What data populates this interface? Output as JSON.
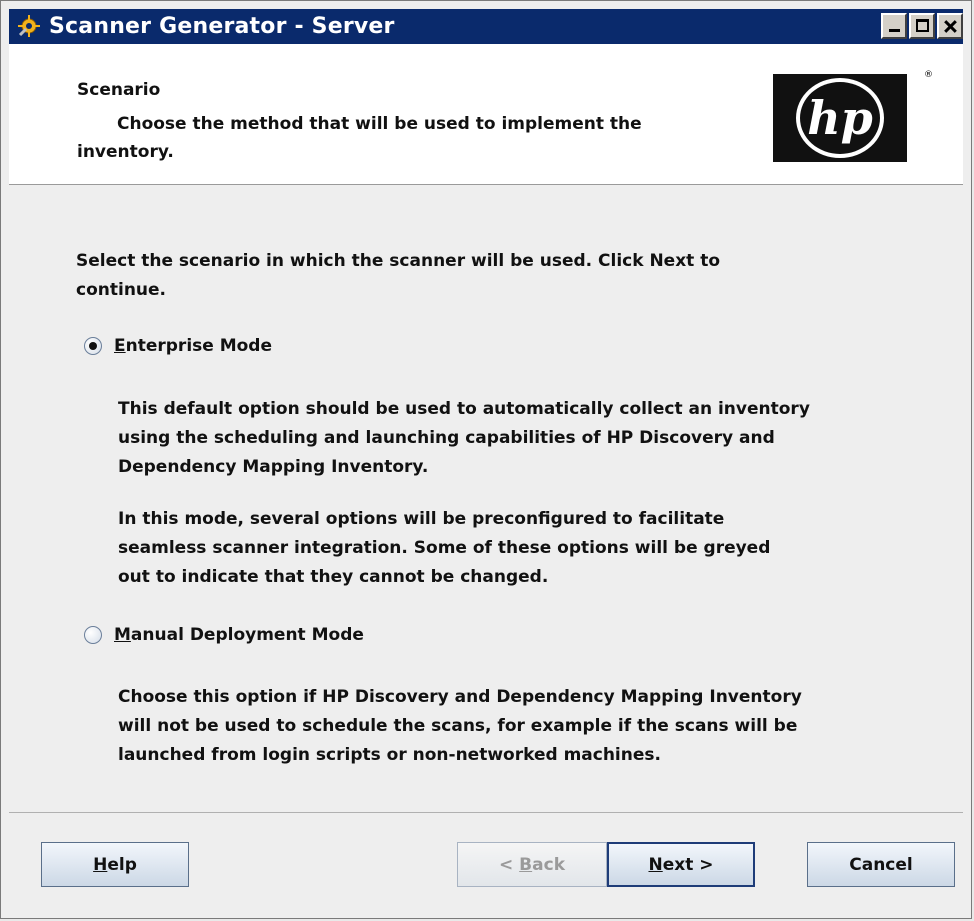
{
  "window": {
    "title": "Scanner Generator - Server"
  },
  "header": {
    "title": "Scenario",
    "description_line1": "Choose the method that will be used to implement the",
    "description_line2": "inventory.",
    "logo_text": "hp",
    "logo_mark": "®"
  },
  "intro": {
    "line1": "Select the scenario in which the scanner will be used.  Click Next to",
    "line2": "continue."
  },
  "options": [
    {
      "mnemonic": "E",
      "label_rest": "nterprise Mode",
      "selected": true,
      "paragraphs": [
        [
          "This default option should be used to automatically collect an inventory",
          "using the scheduling and launching capabilities of HP Discovery and",
          "Dependency Mapping Inventory."
        ],
        [
          "In this mode, several options will be preconfigured to facilitate",
          "seamless scanner integration.  Some of these options will be greyed",
          "out to indicate that they cannot be changed."
        ]
      ]
    },
    {
      "mnemonic": "M",
      "label_rest": "anual Deployment Mode",
      "selected": false,
      "paragraphs": [
        [
          "Choose this option if HP Discovery and Dependency Mapping Inventory",
          "will not be used to schedule the scans, for example if the scans will be",
          "launched from login scripts or non-networked machines."
        ]
      ]
    }
  ],
  "buttons": {
    "help": {
      "mnemonic": "H",
      "rest": "elp"
    },
    "back": {
      "prefix": "< ",
      "mnemonic": "B",
      "rest": "ack"
    },
    "next": {
      "mnemonic": "N",
      "rest": "ext >"
    },
    "cancel": "Cancel"
  },
  "colors": {
    "titlebar": "#0a2a6c",
    "button_gradient_top": "#f2f6fb",
    "button_gradient_bottom": "#ccd8e6"
  },
  "icons": {
    "app": "gear-wrench-icon",
    "minimize": "minimize-icon",
    "maximize": "maximize-icon",
    "close": "close-icon"
  }
}
